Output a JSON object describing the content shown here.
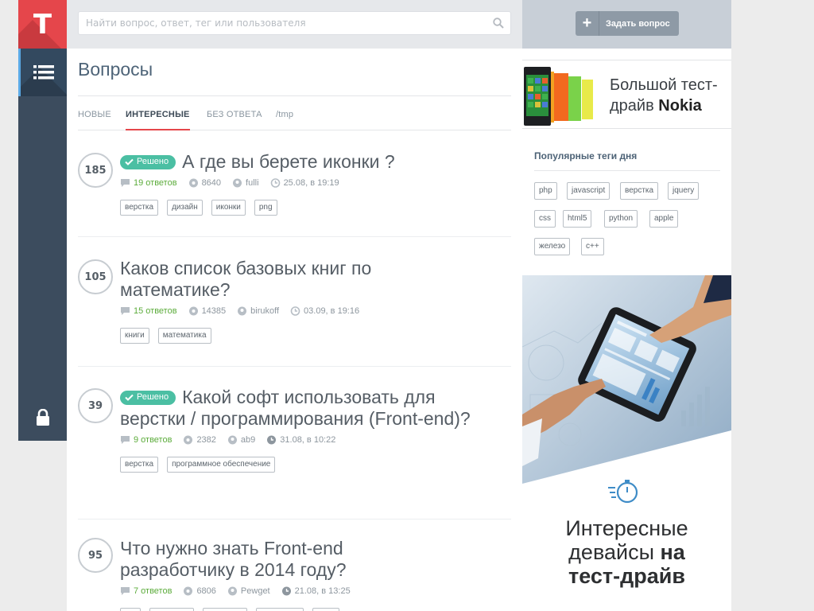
{
  "logo": {
    "letter": "T"
  },
  "search": {
    "placeholder": "Найти вопрос, ответ, тег или пользователя"
  },
  "header": {
    "ask_button": "Задать вопрос"
  },
  "page_title": "Вопросы",
  "tabs": [
    {
      "label": "НОВЫЕ",
      "active": false
    },
    {
      "label": "ИНТЕРЕСНЫЕ",
      "active": true
    },
    {
      "label": "БЕЗ ОТВЕТА",
      "active": false
    },
    {
      "label": "/tmp",
      "active": false
    }
  ],
  "questions": [
    {
      "score": "185",
      "solved": "Решено",
      "title": "А где вы берете иконки ?",
      "answers": "19 ответов",
      "views": "8640",
      "author": "fulli",
      "date": "25.08, в 19:19",
      "tags": [
        "верстка",
        "дизайн",
        "иконки",
        "png"
      ]
    },
    {
      "score": "105",
      "solved": "",
      "title": "Каков список базовых книг по математике?",
      "answers": "15 ответов",
      "views": "14385",
      "author": "birukoff",
      "date": "03.09, в 19:16",
      "tags": [
        "книги",
        "математика"
      ]
    },
    {
      "score": "39",
      "solved": "Решено",
      "title": "Какой софт использовать для верстки / программирования (Front-end)?",
      "answers": "9 ответов",
      "views": "2382",
      "author": "ab9",
      "date": "31.08, в 10:22",
      "tags": [
        "верстка",
        "программное обеспечение"
      ]
    },
    {
      "score": "95",
      "solved": "",
      "title": "Что нужно знать Front-end разработчику в 2014 году?",
      "answers": "7 ответов",
      "views": "6806",
      "author": "Pewget",
      "date": "21.08, в 13:25",
      "tags": []
    }
  ],
  "sidebar_ads": {
    "ad1_line1": "Большой тест-",
    "ad1_line2": "драйв ",
    "ad1_brand": "Nokia",
    "ad2_line1": "Интересные",
    "ad2_line2": "девайсы ",
    "ad2_line2b": "на",
    "ad2_line3": "тест-драйв"
  },
  "popular": {
    "title": "Популярные теги дня",
    "tags": [
      "php",
      "javascript",
      "верстка",
      "jquery",
      "css",
      "html5",
      "python",
      "apple",
      "железо",
      "c++"
    ]
  },
  "colors": {
    "accent": "#e5464b",
    "sidebar": "#3c4c5e",
    "solved": "#4bbfa3",
    "answers": "#5cac3b"
  }
}
